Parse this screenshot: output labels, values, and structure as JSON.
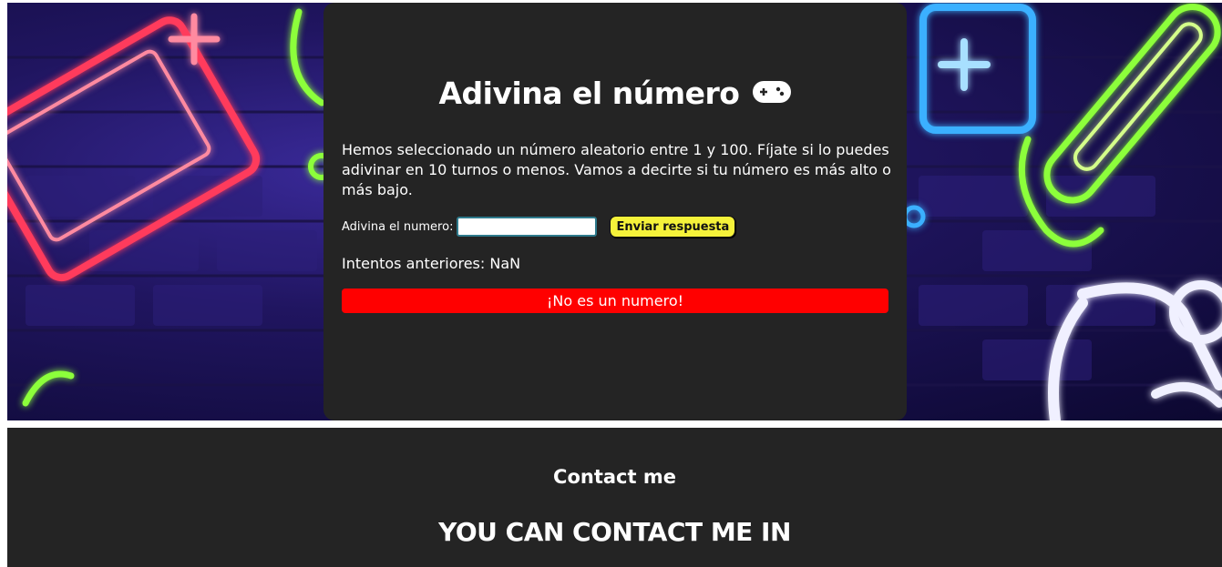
{
  "game": {
    "title": "Adivina el número",
    "title_icon": "gamepad-icon",
    "description": "Hemos seleccionado un número aleatorio entre 1 y 100. Fíjate si lo puedes adivinar en 10 turnos o menos. Vamos a decirte si tu número es más alto o más bajo.",
    "input_label": "Adivina el numero:",
    "input_value": "",
    "submit_label": "Enviar respuesta",
    "previous_label": "Intentos anteriores: NaN",
    "error_message": "¡No es un numero!"
  },
  "footer": {
    "heading": "Contact me",
    "subheading": "YOU CAN CONTACT ME IN"
  },
  "colors": {
    "card_bg": "#242424",
    "error_bg": "#ff0000",
    "button_bg": "#f5f23a",
    "input_border": "#2e7a8c"
  }
}
